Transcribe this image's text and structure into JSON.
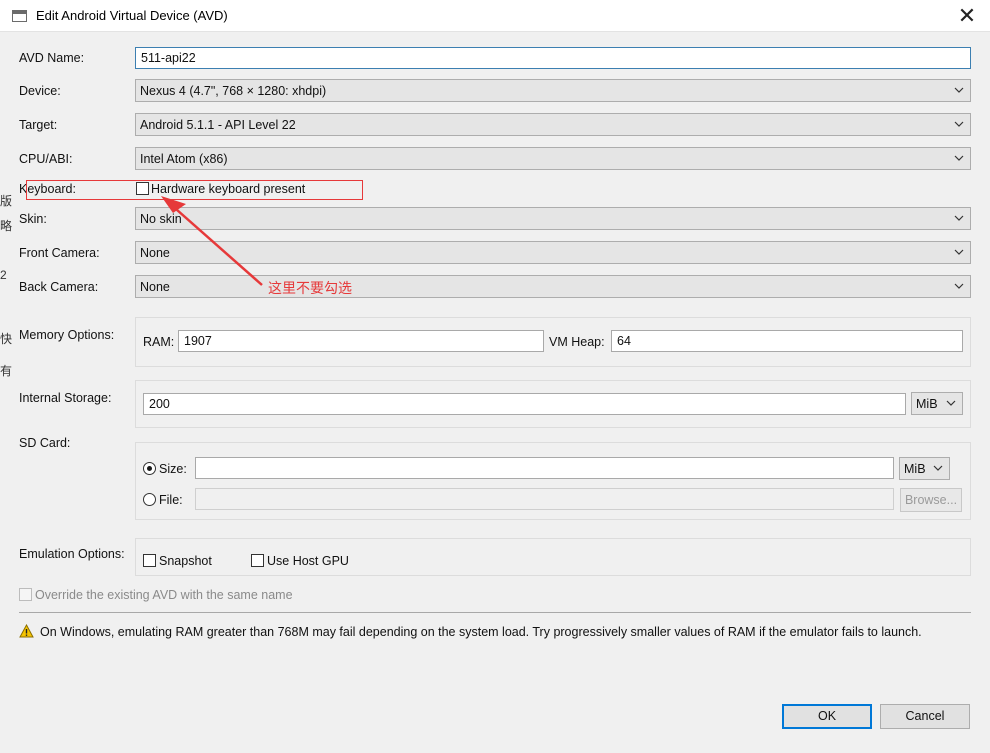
{
  "window": {
    "title": "Edit Android Virtual Device (AVD)",
    "close_symbol": "✕"
  },
  "fields": {
    "avd_name": {
      "label": "AVD Name:",
      "value": "511-api22"
    },
    "device": {
      "label": "Device:",
      "value": "Nexus 4 (4.7\", 768 × 1280: xhdpi)"
    },
    "target": {
      "label": "Target:",
      "value": "Android 5.1.1 - API Level 22"
    },
    "cpu_abi": {
      "label": "CPU/ABI:",
      "value": "Intel Atom (x86)"
    },
    "keyboard": {
      "label": "Keyboard:",
      "checkbox_label": "Hardware keyboard present",
      "checked": false
    },
    "skin": {
      "label": "Skin:",
      "value": "No skin"
    },
    "front_camera": {
      "label": "Front Camera:",
      "value": "None"
    },
    "back_camera": {
      "label": "Back Camera:",
      "value": "None"
    }
  },
  "memory": {
    "label": "Memory Options:",
    "ram_label": "RAM:",
    "ram_value": "1907",
    "vm_heap_label": "VM Heap:",
    "vm_heap_value": "64"
  },
  "internal_storage": {
    "label": "Internal Storage:",
    "value": "200",
    "unit": "MiB"
  },
  "sd_card": {
    "label": "SD Card:",
    "size_label": "Size:",
    "size_value": "",
    "size_unit": "MiB",
    "file_label": "File:",
    "file_value": "",
    "browse_label": "Browse...",
    "selected": "size"
  },
  "emulation": {
    "label": "Emulation Options:",
    "snapshot_label": "Snapshot",
    "snapshot_checked": false,
    "host_gpu_label": "Use Host GPU",
    "host_gpu_checked": false
  },
  "override": {
    "label": "Override the existing AVD with the same name",
    "checked": false
  },
  "warning": {
    "icon": "warning-triangle-icon",
    "text": "On Windows, emulating RAM greater than 768M may fail depending on the system load. Try progressively smaller values of RAM if the emulator fails to launch."
  },
  "buttons": {
    "ok": "OK",
    "cancel": "Cancel"
  },
  "annotation": {
    "text": "这里不要勾选",
    "color": "#e6393a"
  },
  "left_edge_fragments": [
    "版",
    "略",
    "2",
    "快",
    "有"
  ]
}
